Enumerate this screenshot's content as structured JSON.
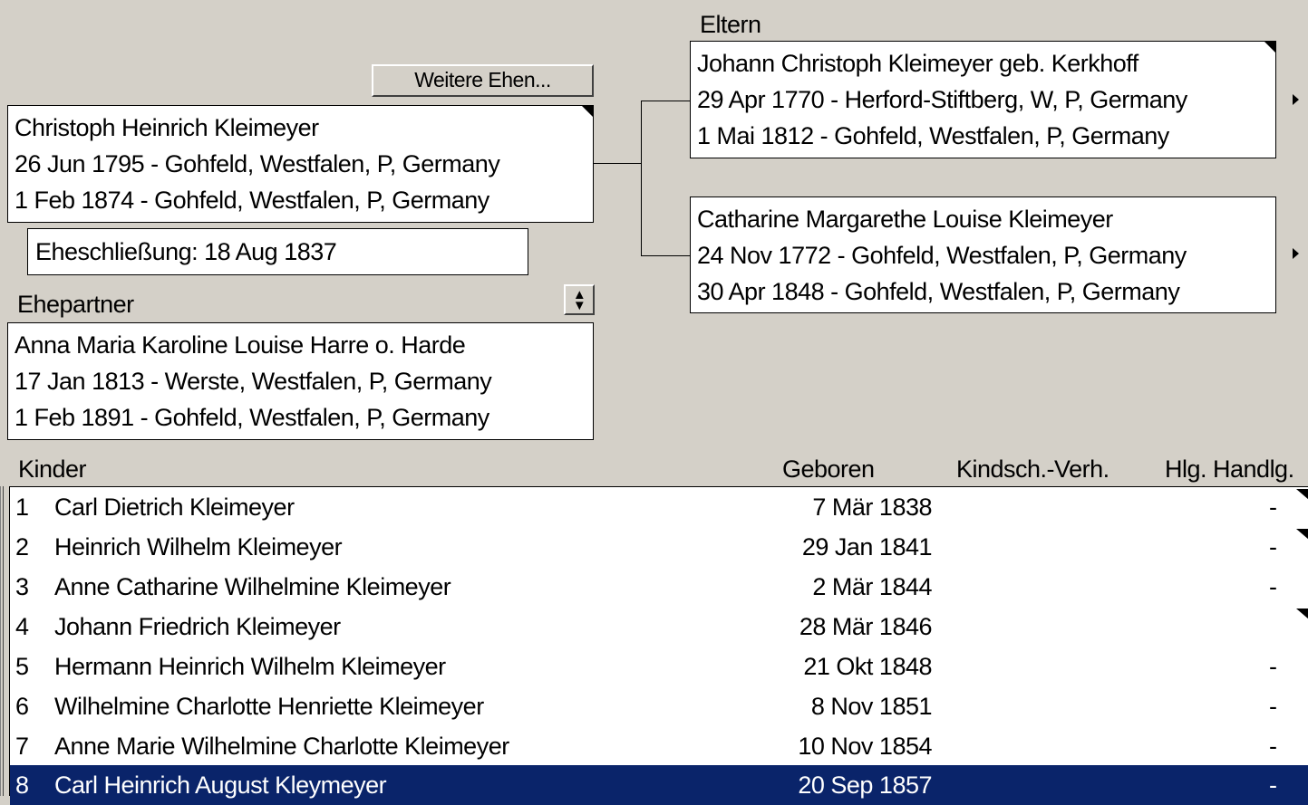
{
  "parents_section": {
    "label": "Eltern",
    "father": {
      "name": "Johann Christoph Kleimeyer geb. Kerkhoff",
      "birth": "29 Apr 1770 - Herford-Stiftberg, W, P, Germany",
      "death": "1 Mai 1812 - Gohfeld, Westfalen, P, Germany"
    },
    "mother": {
      "name": "Catharine Margarethe Louise Kleimeyer",
      "birth": "24 Nov 1772 - Gohfeld, Westfalen, P, Germany",
      "death": "30 Apr 1848 - Gohfeld, Westfalen, P, Germany"
    }
  },
  "more_marriages_button": "Weitere Ehen...",
  "person": {
    "name": "Christoph Heinrich Kleimeyer",
    "birth": "26 Jun 1795 - Gohfeld, Westfalen, P, Germany",
    "death": "1 Feb 1874 - Gohfeld, Westfalen, P, Germany"
  },
  "marriage": {
    "text": "Eheschließung: 18 Aug 1837"
  },
  "spouse_section": {
    "label": "Ehepartner",
    "spouse": {
      "name": "Anna Maria Karoline Louise Harre o. Harde",
      "birth": "17 Jan 1813 - Werste, Westfalen, P, Germany",
      "death": "1 Feb 1891 - Gohfeld, Westfalen, P, Germany"
    }
  },
  "children": {
    "headers": {
      "kinder": "Kinder",
      "born": "Geboren",
      "relation": "Kindsch.-Verh.",
      "ordinance": "Hlg. Handlg."
    },
    "rows": [
      {
        "num": "1",
        "name": "Carl Dietrich Kleimeyer",
        "born": "7 Mär 1838",
        "hlg": "-"
      },
      {
        "num": "2",
        "name": "Heinrich Wilhelm Kleimeyer",
        "born": "29 Jan 1841",
        "hlg": "-"
      },
      {
        "num": "3",
        "name": "Anne Catharine Wilhelmine Kleimeyer",
        "born": "2 Mär 1844",
        "hlg": "-"
      },
      {
        "num": "4",
        "name": "Johann Friedrich Kleimeyer",
        "born": "28 Mär 1846",
        "hlg": ""
      },
      {
        "num": "5",
        "name": "Hermann Heinrich Wilhelm Kleimeyer",
        "born": "21 Okt 1848",
        "hlg": "-"
      },
      {
        "num": "6",
        "name": "Wilhelmine Charlotte Henriette Kleimeyer",
        "born": "8 Nov 1851",
        "hlg": "-"
      },
      {
        "num": "7",
        "name": "Anne Marie Wilhelmine Charlotte Kleimeyer",
        "born": "10 Nov 1854",
        "hlg": "-"
      },
      {
        "num": "8",
        "name": "Carl Heinrich August Kleymeyer",
        "born": "20 Sep 1857",
        "hlg": "-"
      }
    ]
  },
  "colors": {
    "background": "#d4d0c8",
    "selection": "#0a246a"
  }
}
